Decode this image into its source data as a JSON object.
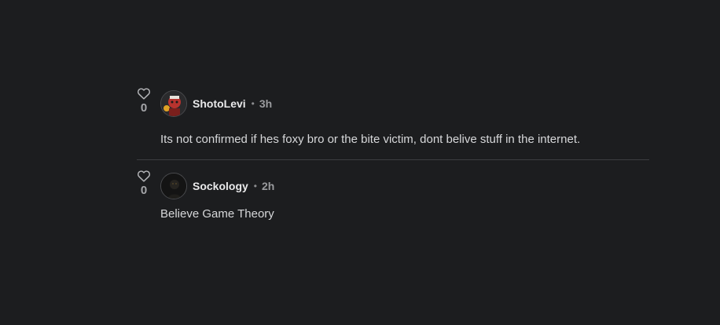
{
  "comments": [
    {
      "likes": "0",
      "username": "ShotoLevi",
      "separator": "•",
      "time": "3h",
      "text": "Its not confirmed if hes foxy bro or the bite victim, dont belive stuff in the internet.",
      "avatar_icon": "avatar-red-character"
    },
    {
      "likes": "0",
      "username": "Sockology",
      "separator": "•",
      "time": "2h",
      "text": "Believe Game Theory",
      "avatar_icon": "avatar-dark-figure"
    }
  ],
  "colors": {
    "background": "#1c1d1f",
    "divider": "#3d3e41",
    "username": "#e9e9ea",
    "meta": "#9a9b9e"
  }
}
